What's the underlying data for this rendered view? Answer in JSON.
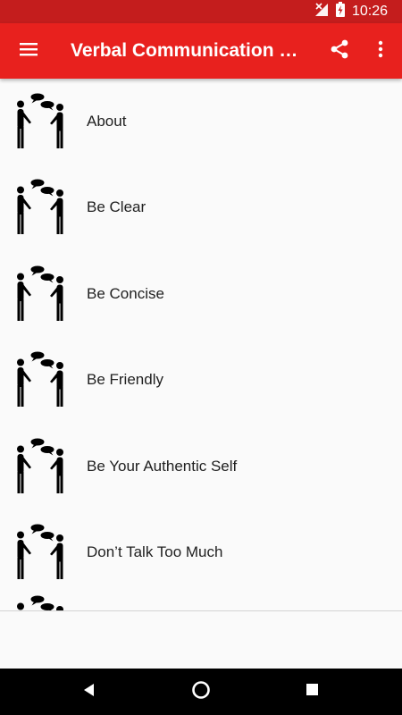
{
  "status_bar": {
    "time": "10:26",
    "icons": [
      "signal-off-icon",
      "battery-charging-icon"
    ],
    "background": "#c41d1d"
  },
  "app_bar": {
    "title": "Verbal Communication S…",
    "background": "#e8211e",
    "icons": [
      "hamburger-menu-icon",
      "share-icon",
      "more-vert-icon"
    ]
  },
  "topics": [
    {
      "label": "About",
      "icon": "conversation-people-icon"
    },
    {
      "label": "Be Clear",
      "icon": "conversation-people-icon"
    },
    {
      "label": "Be Concise",
      "icon": "conversation-people-icon"
    },
    {
      "label": "Be Friendly",
      "icon": "conversation-people-icon"
    },
    {
      "label": "Be Your Authentic Self",
      "icon": "conversation-people-icon"
    },
    {
      "label": "Don’t Talk Too Much",
      "icon": "conversation-people-icon"
    }
  ],
  "navigation_bar": {
    "icons": [
      "back-icon",
      "home-icon",
      "recents-icon"
    ],
    "background": "#000000"
  }
}
